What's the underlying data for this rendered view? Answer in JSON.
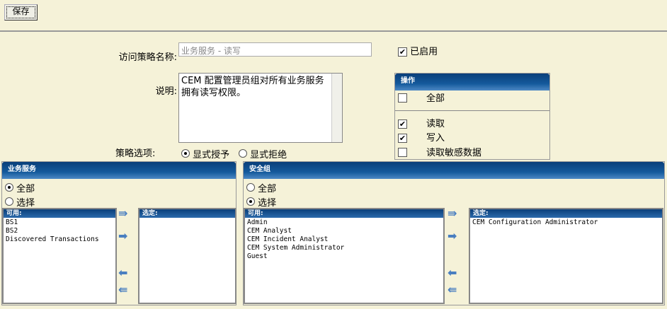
{
  "toolbar": {
    "save_label": "保存"
  },
  "form": {
    "name_label": "访问策略名称:",
    "name_value": "业务服务 - 读写",
    "enabled_label": "已启用",
    "enabled": true,
    "desc_label": "说明:",
    "desc_value": "CEM 配置管理员组对所有业务服务拥有读写权限。",
    "policy_label": "策略选项:",
    "policy_options": [
      "显式授予",
      "显式拒绝"
    ],
    "policy_selected": 0
  },
  "operations": {
    "title": "操作",
    "all": "全部",
    "items": [
      {
        "label": "读取",
        "checked": true
      },
      {
        "label": "写入",
        "checked": true
      },
      {
        "label": "读取敏感数据",
        "checked": false
      }
    ]
  },
  "business": {
    "title": "业务服务",
    "all": "全部",
    "select": "选择",
    "selected_mode": "all",
    "available_label": "可用:",
    "selected_label": "选定:",
    "available": [
      "BS1",
      "BS2",
      "Discovered Transactions"
    ],
    "chosen": []
  },
  "security": {
    "title": "安全组",
    "all": "全部",
    "select": "选择",
    "selected_mode": "select",
    "available_label": "可用:",
    "selected_label": "选定:",
    "available": [
      "Admin",
      "CEM Analyst",
      "CEM Incident Analyst",
      "CEM System Administrator",
      "Guest"
    ],
    "chosen": [
      "CEM Configuration Administrator"
    ]
  }
}
